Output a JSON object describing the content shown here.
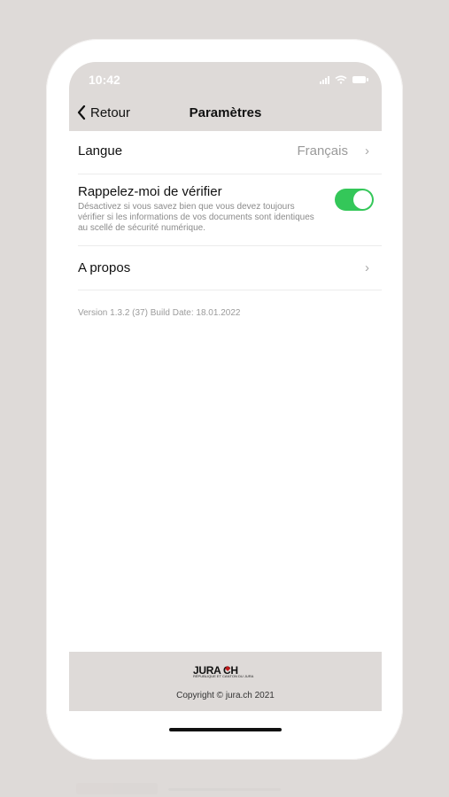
{
  "status": {
    "time": "10:42"
  },
  "nav": {
    "back_label": "Retour",
    "title": "Paramètres"
  },
  "settings": {
    "language": {
      "label": "Langue",
      "value": "Français"
    },
    "reminder": {
      "label": "Rappelez-moi de vérifier",
      "description": "Désactivez si vous savez bien que vous devez toujours vérifier si les informations de vos documents sont identiques au scellé de sécurité numérique.",
      "enabled": true
    },
    "about": {
      "label": "A propos"
    }
  },
  "version_text": "Version 1.3.2 (37) Build Date: 18.01.2022",
  "footer": {
    "logo_main": "JURA CH",
    "logo_sub": "RÉPUBLIQUE ET CANTON DU JURA",
    "copyright": "Copyright © jura.ch 2021"
  },
  "colors": {
    "toggle_on": "#34c759",
    "background": "#dedad8"
  },
  "icons": {
    "back": "chevron-left-icon",
    "row_arrow": "chevron-right-icon",
    "wifi": "wifi-icon",
    "battery": "battery-icon",
    "signal": "cellular-signal-icon",
    "logo": "jura-logo"
  }
}
